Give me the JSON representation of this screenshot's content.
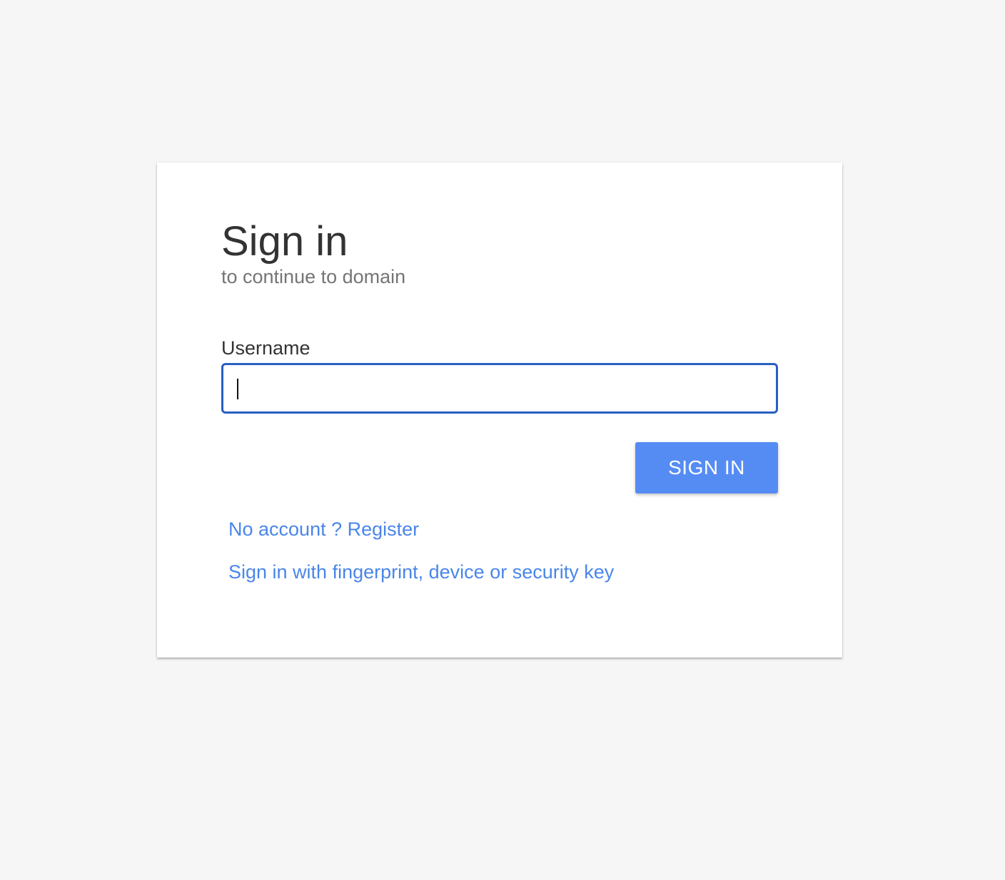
{
  "signin": {
    "title": "Sign in",
    "subtitle": "to continue to domain",
    "username_label": "Username",
    "username_value": "",
    "button_label": "SIGN IN",
    "register_link": "No account ? Register",
    "webauthn_link": "Sign in with fingerprint, device or security key"
  },
  "colors": {
    "page_background": "#f6f6f6",
    "card_background": "#ffffff",
    "input_focus_border": "#2660c2",
    "button_background": "#558cf4",
    "link": "#4a86e8"
  }
}
